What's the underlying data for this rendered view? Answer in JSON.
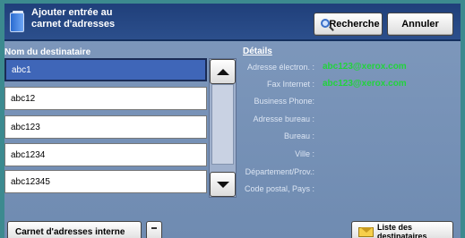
{
  "header": {
    "title_line1": "Ajouter entrée au",
    "title_line2": "carnet d'adresses",
    "search_label": "Recherche",
    "cancel_label": "Annuler"
  },
  "recipients": {
    "heading": "Nom du destinataire",
    "items": [
      {
        "label": "abc1",
        "selected": true
      },
      {
        "label": "abc12",
        "selected": false
      },
      {
        "label": "abc123",
        "selected": false
      },
      {
        "label": "abc1234",
        "selected": false
      },
      {
        "label": "abc12345",
        "selected": false
      }
    ]
  },
  "details": {
    "heading": "Détails",
    "fields": [
      {
        "label": "Adresse électron. :",
        "value": "abc123@xerox.com"
      },
      {
        "label": "Fax Internet :",
        "value": "abc123@xerox.com"
      },
      {
        "label": "Business Phone:",
        "value": ""
      },
      {
        "label": "Adresse bureau :",
        "value": ""
      },
      {
        "label": "Bureau :",
        "value": ""
      },
      {
        "label": "Ville :",
        "value": ""
      },
      {
        "label": "Département/Prov.:",
        "value": ""
      },
      {
        "label": "Code postal, Pays :",
        "value": ""
      }
    ]
  },
  "footer": {
    "address_book_label": "Carnet d'adresses interne",
    "recipient_list_label": "Liste des destinataires"
  },
  "colors": {
    "accent_value": "#22d33c",
    "header": "#1f3f7a",
    "selected_row": "#3f66b8"
  }
}
